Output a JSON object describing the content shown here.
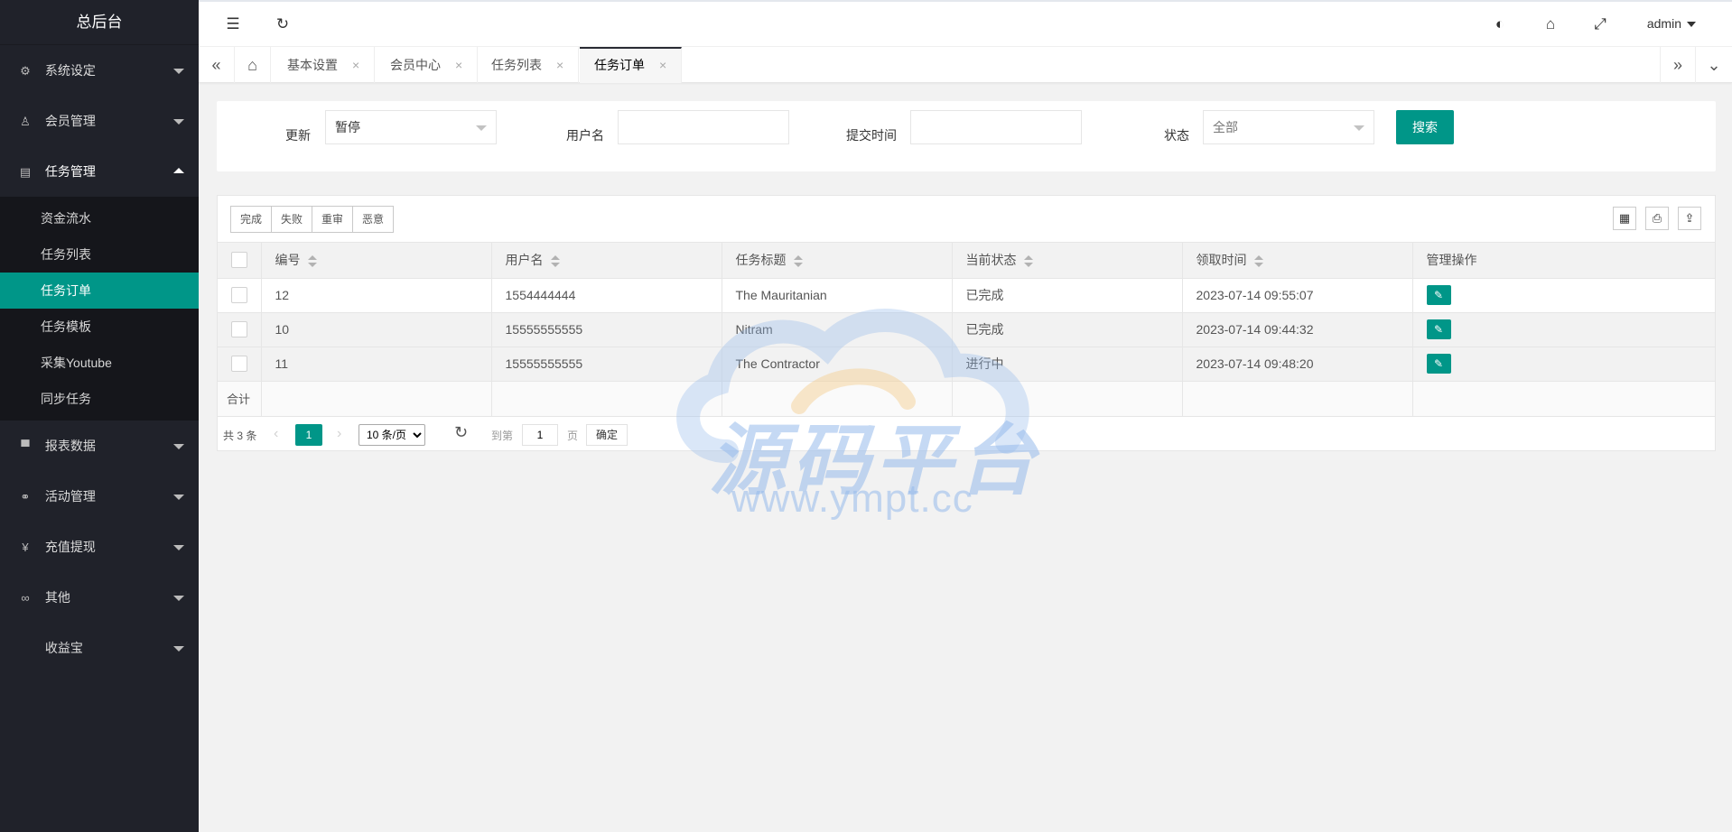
{
  "sidebar": {
    "title": "总后台",
    "menu": [
      {
        "label": "系统设定",
        "icon": "gear-icon",
        "glyph": "⚙"
      },
      {
        "label": "会员管理",
        "icon": "user-icon",
        "glyph": "♙"
      },
      {
        "label": "任务管理",
        "icon": "document-icon",
        "glyph": "▤"
      }
    ],
    "sub_items": [
      "资金流水",
      "任务列表",
      "任务订单",
      "任务模板",
      "采集Youtube",
      "同步任务"
    ],
    "menu2": [
      {
        "label": "报表数据",
        "icon": "report-icon",
        "glyph": "▀"
      },
      {
        "label": "活动管理",
        "icon": "activity-icon",
        "glyph": "⚭"
      },
      {
        "label": "充值提现",
        "icon": "yen-icon",
        "glyph": "¥"
      },
      {
        "label": "其他",
        "icon": "link-icon",
        "glyph": "∞"
      },
      {
        "label": "收益宝",
        "icon": "",
        "glyph": ""
      }
    ]
  },
  "header": {
    "user": "admin"
  },
  "tabs": [
    {
      "label": "基本设置"
    },
    {
      "label": "会员中心"
    },
    {
      "label": "任务列表"
    },
    {
      "label": "任务订单"
    }
  ],
  "filter": {
    "update_label": "更新",
    "update_value": "暂停",
    "username_label": "用户名",
    "submit_time_label": "提交时间",
    "status_label": "状态",
    "status_value": "全部",
    "search_label": "搜索"
  },
  "toolbar": {
    "buttons": [
      "完成",
      "失败",
      "重审",
      "恶意"
    ]
  },
  "table": {
    "headers": [
      "编号",
      "用户名",
      "任务标题",
      "当前状态",
      "领取时间",
      "管理操作"
    ],
    "rows": [
      {
        "id": "12",
        "username": "1554444444",
        "title": "The Mauritanian",
        "status": "已完成",
        "time": "2023-07-14 09:55:07"
      },
      {
        "id": "10",
        "username": "15555555555",
        "title": "Nitram",
        "status": "已完成",
        "time": "2023-07-14 09:44:32"
      },
      {
        "id": "11",
        "username": "15555555555",
        "title": "The Contractor",
        "status": "进行中",
        "time": "2023-07-14 09:48:20"
      }
    ],
    "summary_label": "合计"
  },
  "pager": {
    "total": "共 3 条",
    "current": "1",
    "page_size": "10 条/页",
    "goto_label": "到第",
    "goto_value": "1",
    "page_label": "页",
    "confirm": "确定"
  },
  "watermark": {
    "text": "源码平台",
    "url": "www.ympt.cc"
  }
}
